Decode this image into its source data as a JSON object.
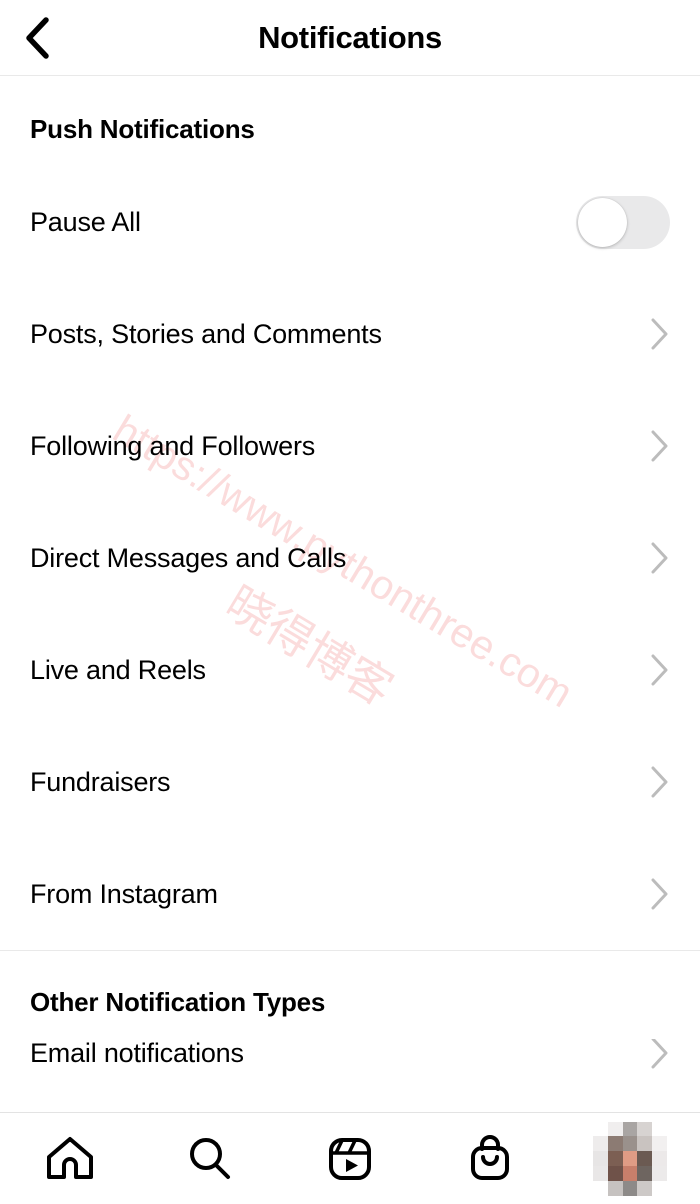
{
  "header": {
    "title": "Notifications",
    "back_icon": "chevron-left-icon"
  },
  "sections": [
    {
      "id": "push",
      "title": "Push Notifications",
      "rows": [
        {
          "label": "Pause All",
          "control": "toggle",
          "toggle_on": false
        },
        {
          "label": "Posts, Stories and Comments",
          "control": "chevron"
        },
        {
          "label": "Following and Followers",
          "control": "chevron"
        },
        {
          "label": "Direct Messages and Calls",
          "control": "chevron"
        },
        {
          "label": "Live and Reels",
          "control": "chevron"
        },
        {
          "label": "Fundraisers",
          "control": "chevron"
        },
        {
          "label": "From Instagram",
          "control": "chevron"
        }
      ]
    },
    {
      "id": "other",
      "title": "Other Notification Types",
      "rows": [
        {
          "label": "Email notifications",
          "control": "chevron"
        }
      ]
    }
  ],
  "watermark": {
    "url": "https://www.pythonthree.com",
    "site_name": "晓得博客",
    "color": "#fbdcdc"
  },
  "bottom_nav": {
    "items": [
      {
        "icon": "home-icon",
        "name": "nav-home"
      },
      {
        "icon": "search-icon",
        "name": "nav-search"
      },
      {
        "icon": "reels-icon",
        "name": "nav-reels"
      },
      {
        "icon": "shop-icon",
        "name": "nav-shop"
      },
      {
        "icon": "profile-avatar",
        "name": "nav-profile"
      }
    ]
  },
  "colors": {
    "text": "#000000",
    "chevron": "#bcbcbc",
    "divider": "#e9e9e9",
    "toggle_track_off": "#e9e9ea",
    "toggle_knob": "#ffffff",
    "background": "#ffffff"
  },
  "avatar_pixels": [
    "#ffffff",
    "#f0eeee",
    "#a9a5a3",
    "#d7d3d1",
    "#ffffff",
    "#eeecec",
    "#8c7b73",
    "#9a918c",
    "#c9c3c0",
    "#f2f0f0",
    "#e7e5e5",
    "#7c5f53",
    "#e09c85",
    "#6b5a52",
    "#ece9e9",
    "#e9e7e7",
    "#6f5249",
    "#c87f6b",
    "#6e6560",
    "#eceaea",
    "#ffffff",
    "#c6c2c0",
    "#8d8a88",
    "#cdc9c7",
    "#ffffff"
  ]
}
